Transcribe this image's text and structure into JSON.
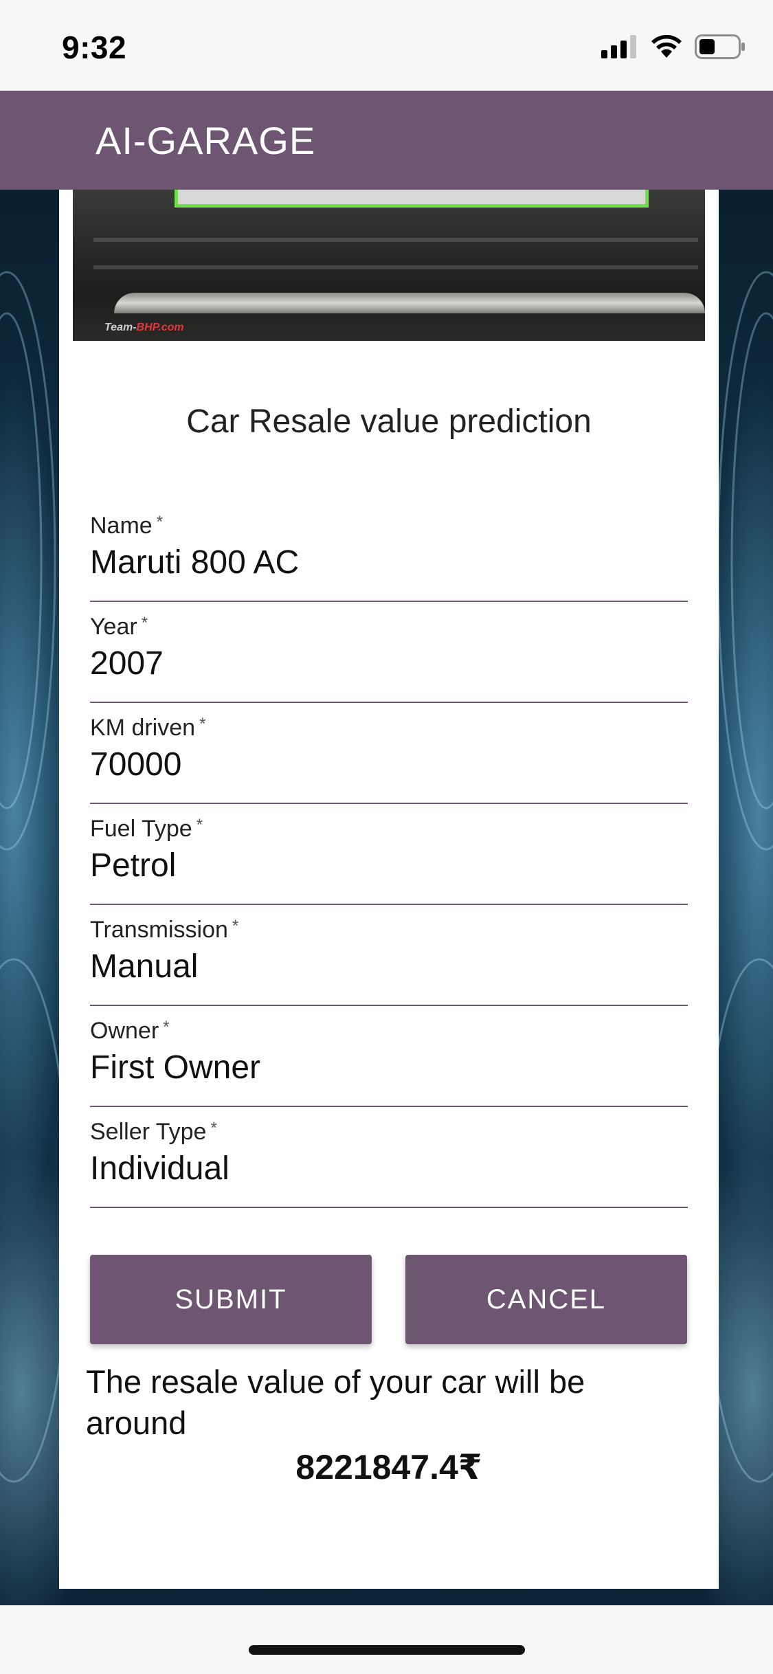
{
  "status_bar": {
    "time": "9:32"
  },
  "app_bar": {
    "title": "AI-GARAGE",
    "color": "#6e5673"
  },
  "car_image": {
    "watermark_prefix": "Team-",
    "watermark_highlight": "BHP.com"
  },
  "form": {
    "title": "Car Resale value prediction",
    "required_marker": "*",
    "fields": [
      {
        "label": "Name",
        "value": "Maruti 800 AC"
      },
      {
        "label": "Year",
        "value": "2007"
      },
      {
        "label": "KM driven",
        "value": "70000"
      },
      {
        "label": "Fuel Type",
        "value": "Petrol"
      },
      {
        "label": "Transmission",
        "value": "Manual"
      },
      {
        "label": "Owner",
        "value": "First Owner"
      },
      {
        "label": "Seller Type",
        "value": "Individual"
      }
    ],
    "submit_label": "SUBMIT",
    "cancel_label": "CANCEL"
  },
  "result": {
    "text": "The resale value of your car will be around",
    "value": "8221847.4₹"
  }
}
